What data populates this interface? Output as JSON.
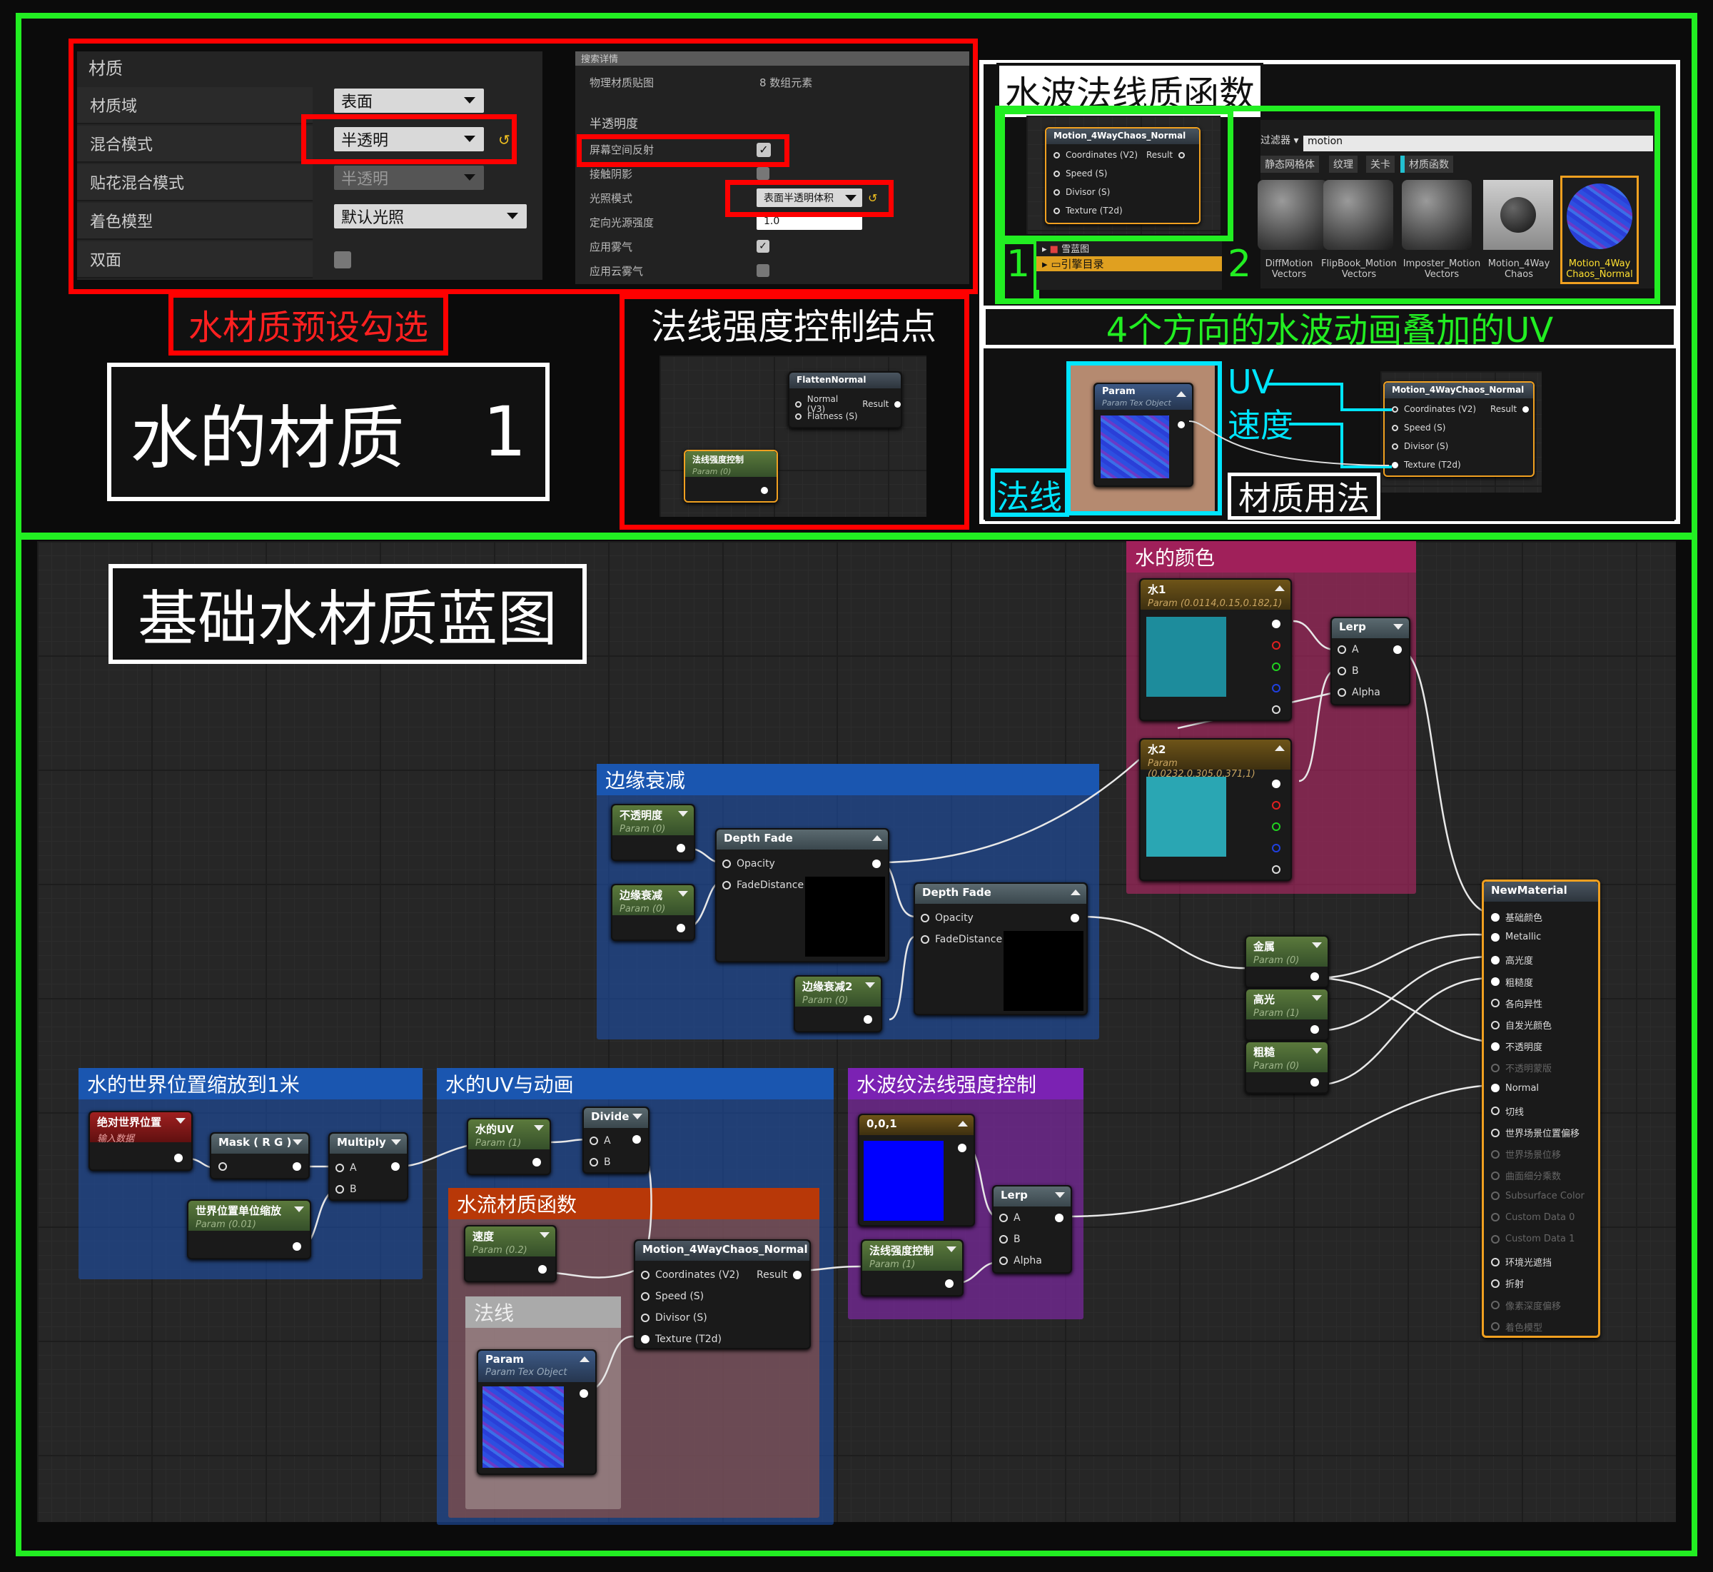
{
  "props": {
    "header": "材质",
    "rows": [
      "材质域",
      "混合模式",
      "贴花混合模式",
      "着色模型",
      "双面"
    ],
    "domain_value": "表面",
    "blend_value": "半透明",
    "decal_value": "半透明",
    "shading_value": "默认光照"
  },
  "details": {
    "top_label": "搜索详情",
    "phys_label": "物理材质贴图",
    "phys_value": "8 数组元素",
    "section": "半透明度",
    "rows": [
      "屏幕空间反射",
      "接触阴影",
      "光照模式",
      "定向光源强度",
      "应用雾气",
      "应用云雾气"
    ],
    "lighting_value": "表面半透明体积",
    "intensity_value": "1.0"
  },
  "captions": {
    "preset": "水材质预设勾选",
    "title1": "水的材质",
    "title1_num": "1",
    "flatten_title": "法线强度控制结点",
    "wave_func": "水波法线质函数",
    "uv_caption": "4个方向的水波动画叠加的UV",
    "uv_label": "UV",
    "speed_label": "速度",
    "normal_label": "法线",
    "usage_label": "材质用法",
    "blueprint": "基础水材质蓝图",
    "num1": "1",
    "num2": "2"
  },
  "browser": {
    "filter": "过滤器",
    "search": "motion",
    "tabs": [
      "静态网格体",
      "纹理",
      "关卡",
      "材质函数"
    ],
    "tree": [
      "雪蓝图",
      "引擎目录"
    ],
    "assets": [
      {
        "l1": "DiffMotion",
        "l2": "Vectors"
      },
      {
        "l1": "FlipBook_Motion",
        "l2": "Vectors"
      },
      {
        "l1": "Imposter_Motion",
        "l2": "Vectors"
      },
      {
        "l1": "Motion_4Way",
        "l2": "Chaos"
      },
      {
        "l1": "Motion_4Way",
        "l2": "Chaos_Normal"
      }
    ]
  },
  "fn_node": {
    "title": "Motion_4WayChaos_Normal",
    "pins": [
      "Coordinates (V2)",
      "Speed (S)",
      "Divisor (S)",
      "Texture (T2d)"
    ],
    "out": "Result"
  },
  "flatten": {
    "title": "FlattenNormal",
    "pins": [
      "Normal (V3)",
      "Flatness (S)"
    ],
    "out": "Result",
    "param_title": "法线强度控制",
    "param_sub": "Param (0)"
  },
  "param_tex": {
    "title": "Param",
    "sub": "Param Tex Object"
  },
  "graph": {
    "comments": {
      "color": "水的颜色",
      "edge": "边缘衰减",
      "world": "水的世界位置缩放到1米",
      "uv": "水的UV与动画",
      "flow": "水流材质函数",
      "normal": "法线",
      "strength": "水波纹法线强度控制"
    },
    "water1": {
      "title": "水1",
      "sub": "Param (0.0114,0.15,0.182,1)",
      "color": "#1d8c9c"
    },
    "water2": {
      "title": "水2",
      "sub": "Param (0.0232,0.305,0.371,1)",
      "color": "#2aa6b3"
    },
    "lerp": {
      "title": "Lerp",
      "a": "A",
      "b": "B",
      "alpha": "Alpha"
    },
    "opacity_p": {
      "title": "不透明度",
      "sub": "Param (0)"
    },
    "edge_p": {
      "title": "边缘衰减",
      "sub": "Param (0)"
    },
    "edge2_p": {
      "title": "边缘衰减2",
      "sub": "Param (0)"
    },
    "depth": {
      "title": "Depth Fade",
      "opacity": "Opacity",
      "fade": "FadeDistance"
    },
    "metal": {
      "title": "金属",
      "sub": "Param (0)"
    },
    "spec": {
      "title": "高光",
      "sub": "Param (1)"
    },
    "rough": {
      "title": "粗糙",
      "sub": "Param (0)"
    },
    "absworld": {
      "title": "绝对世界位置",
      "sub": "输入数据"
    },
    "mask": {
      "title": "Mask ( R G )"
    },
    "multiply": {
      "title": "Multiply",
      "a": "A",
      "b": "B"
    },
    "scale": {
      "title": "世界位置单位缩放",
      "sub": "Param (0.01)"
    },
    "wateruv": {
      "title": "水的UV",
      "sub": "Param (1)"
    },
    "divide": {
      "title": "Divide",
      "a": "A",
      "b": "B"
    },
    "speed": {
      "title": "速度",
      "sub": "Param (0.2)"
    },
    "const": {
      "title": "0,0,1"
    },
    "strength_p": {
      "title": "法线强度控制",
      "sub": "Param (1)"
    },
    "newmat": {
      "title": "NewMaterial",
      "pins": [
        "基础颜色",
        "Metallic",
        "高光度",
        "粗糙度",
        "各向异性",
        "自发光颜色",
        "不透明度",
        "不透明蒙版",
        "Normal",
        "切线",
        "世界场景位置偏移",
        "世界场景位移",
        "曲面细分乘数",
        "Subsurface Color",
        "Custom Data 0",
        "Custom Data 1",
        "环境光遮挡",
        "折射",
        "像素深度偏移",
        "着色模型"
      ],
      "dim": [
        7,
        11,
        12,
        13,
        14,
        15,
        18,
        19
      ]
    }
  },
  "colors": {
    "green": "#22ee22",
    "red": "#ff0000",
    "cyan": "#00e5ff",
    "orange": "#f0a020"
  }
}
